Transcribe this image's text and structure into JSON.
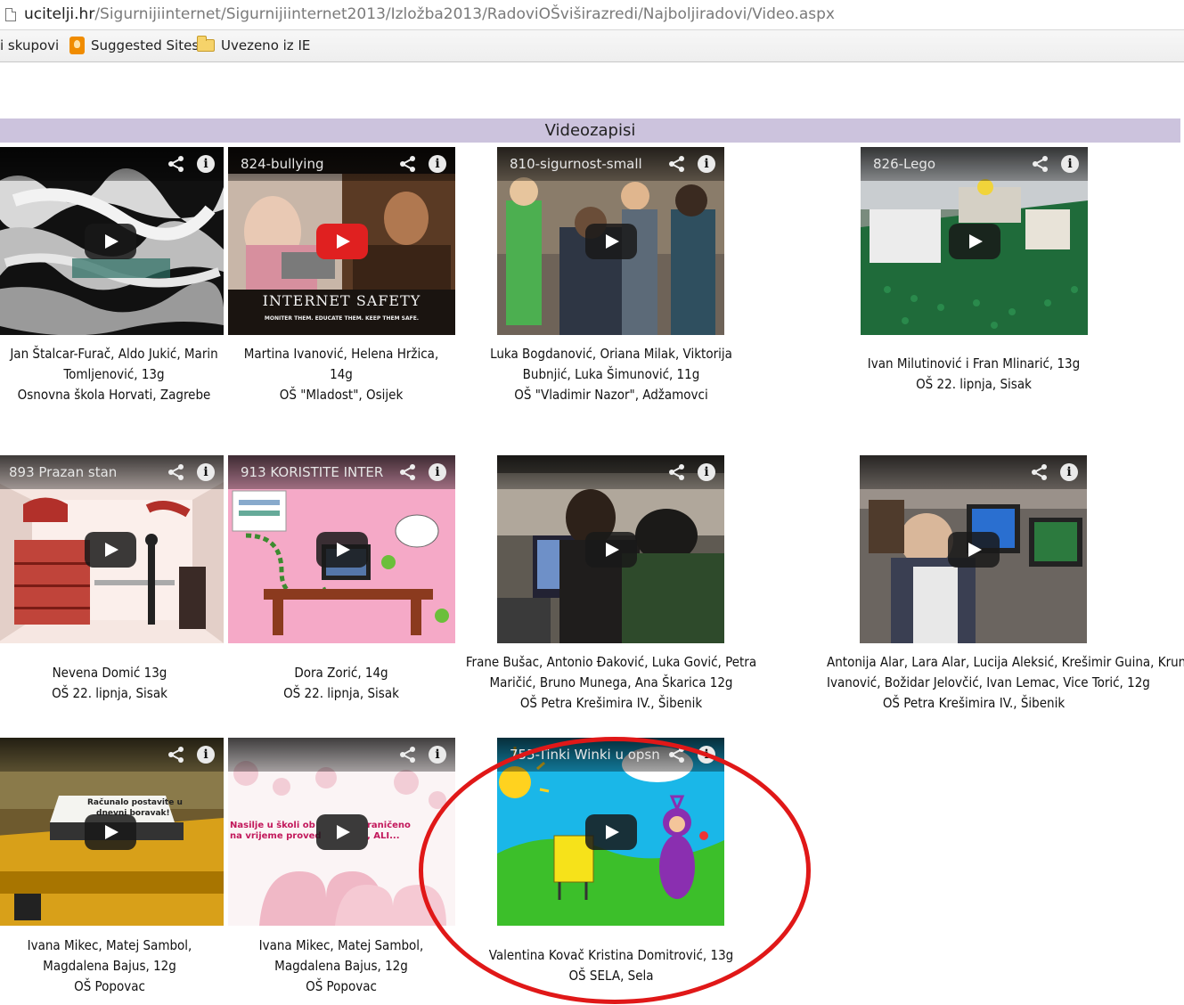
{
  "browser": {
    "url_host": "ucitelji.hr",
    "url_path": "/Sigurnijiinternet/Sigurnijiinternet2013/Izložba2013/RadoviOŠviširazredi/Najboljiradovi/Video.aspx",
    "bookmarks": [
      "i skupovi",
      "Suggested Sites",
      "Uvezeno iz IE"
    ]
  },
  "section": {
    "title": "Videozapisi"
  },
  "videos": [
    {
      "title": "",
      "caption": [
        "Jan Štalcar-Furač, Aldo Jukić, Marin",
        "Tomljenović, 13g",
        "Osnovna škola Horvati, Zagrebe"
      ]
    },
    {
      "title": "824-bullying",
      "overlay_text": [
        "INTERNET SAFETY",
        "MONITER THEM. EDUCATE THEM. KEEP THEM SAFE."
      ],
      "caption": [
        "Martina Ivanović, Helena Hržica,",
        "14g",
        "OŠ \"Mladost\", Osijek"
      ]
    },
    {
      "title": "810-sigurnost-small",
      "caption": [
        "Luka Bogdanović, Oriana Milak, Viktorija",
        "Bubnjić, Luka Šimunović, 11g",
        "OŠ \"Vladimir Nazor\", Adžamovci"
      ]
    },
    {
      "title": "826-Lego",
      "caption": [
        "Ivan Milutinović i Fran Mlinarić, 13g",
        "OŠ 22. lipnja, Sisak"
      ]
    },
    {
      "title": "893 Prazan stan",
      "caption": [
        "Nevena Domić 13g",
        "OŠ 22. lipnja, Sisak"
      ]
    },
    {
      "title": "913 KORISTITE INTER",
      "caption": [
        "Dora Zorić, 14g",
        "OŠ 22. lipnja, Sisak"
      ]
    },
    {
      "title": "",
      "caption": [
        "Frane Bušac, Antonio Đaković, Luka Gović, Petra",
        "Maričić, Bruno Munega, Ana Škarica 12g",
        "OŠ Petra Krešimira IV., Šibenik"
      ]
    },
    {
      "title": "",
      "caption": [
        "Antonija Alar, Lara Alar, Lucija Aleksić, Krešimir Guina, Krunoslav",
        "Ivanović, Božidar Jelovčić, Ivan Lemac, Vice Torić, 12g",
        "OŠ Petra Krešimira IV., Šibenik"
      ]
    },
    {
      "title": "",
      "overlay_text": [
        "Računalo postavite u",
        "dnevni boravak!"
      ],
      "caption": [
        "Ivana Mikec, Matej Sambol,",
        "Magdalena Bajus, 12g",
        "OŠ Popovac"
      ]
    },
    {
      "title": "",
      "overlay_text": [
        "Nasilje u školi ob",
        "na vrijeme proved",
        "raničeno",
        ", ALI..."
      ],
      "caption": [
        "Ivana Mikec, Matej Sambol,",
        "Magdalena Bajus, 12g",
        "OŠ Popovac"
      ]
    },
    {
      "title": "755-Tinki Winki u opsn",
      "caption": [
        "Valentina Kovač Kristina Domitrović, 13g",
        "OŠ SELA, Sela"
      ]
    }
  ],
  "icons": {
    "share": "share-icon",
    "info": "info-icon",
    "play": "play-icon"
  },
  "colors": {
    "section_header_bg": "#ccc3dd",
    "annotation_ring": "#e01818",
    "youtube_red": "#e02020"
  }
}
